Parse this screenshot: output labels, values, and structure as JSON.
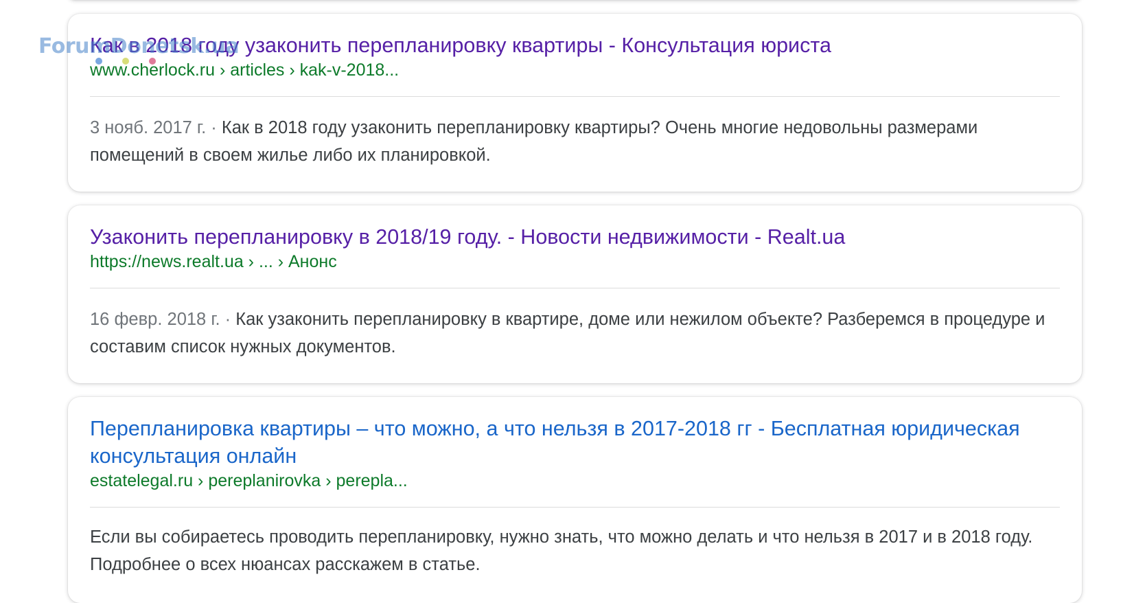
{
  "watermark": {
    "text": "ForumDonetsk.ua",
    "dot_colors": [
      "#7aa7e0",
      "#d8dd7a",
      "#e07a9a"
    ]
  },
  "colors": {
    "visited_link": "#5620a6",
    "link": "#1a66c9",
    "url_green": "#0d7a2a",
    "snippet_text": "#3c4043",
    "date_gray": "#70757a"
  },
  "results": [
    {
      "title": "Как в 2018 году узаконить перепланировку квартиры - Консультация юриста",
      "url": "www.cherlock.ru › articles › kak-v-2018...",
      "date": "3 нояб. 2017 г. · ",
      "snippet": "Как в 2018 году узаконить перепланировку квартиры? Очень многие недовольны размерами помещений в своем жилье либо их планировкой."
    },
    {
      "title": "Узаконить перепланировку в 2018/19 году. - Новости недвижимости - Realt.ua",
      "url": "https://news.realt.ua › ... › Анонс",
      "date": "16 февр. 2018 г. · ",
      "snippet": "Как узаконить перепланировку в квартире, доме или нежилом объекте? Разберемся в процедуре и составим список нужных документов."
    },
    {
      "title": "Перепланировка квартиры – что можно, а что нельзя в 2017-2018 гг - Бесплатная юридическая консультация онлайн",
      "url": "estatelegal.ru › pereplanirovka › perepla...",
      "date": "",
      "snippet": "Если вы собираетесь проводить перепланировку, нужно знать, что можно делать и что нельзя в 2017 и в 2018 году. Подробнее о всех нюансах расскажем в статье."
    }
  ]
}
